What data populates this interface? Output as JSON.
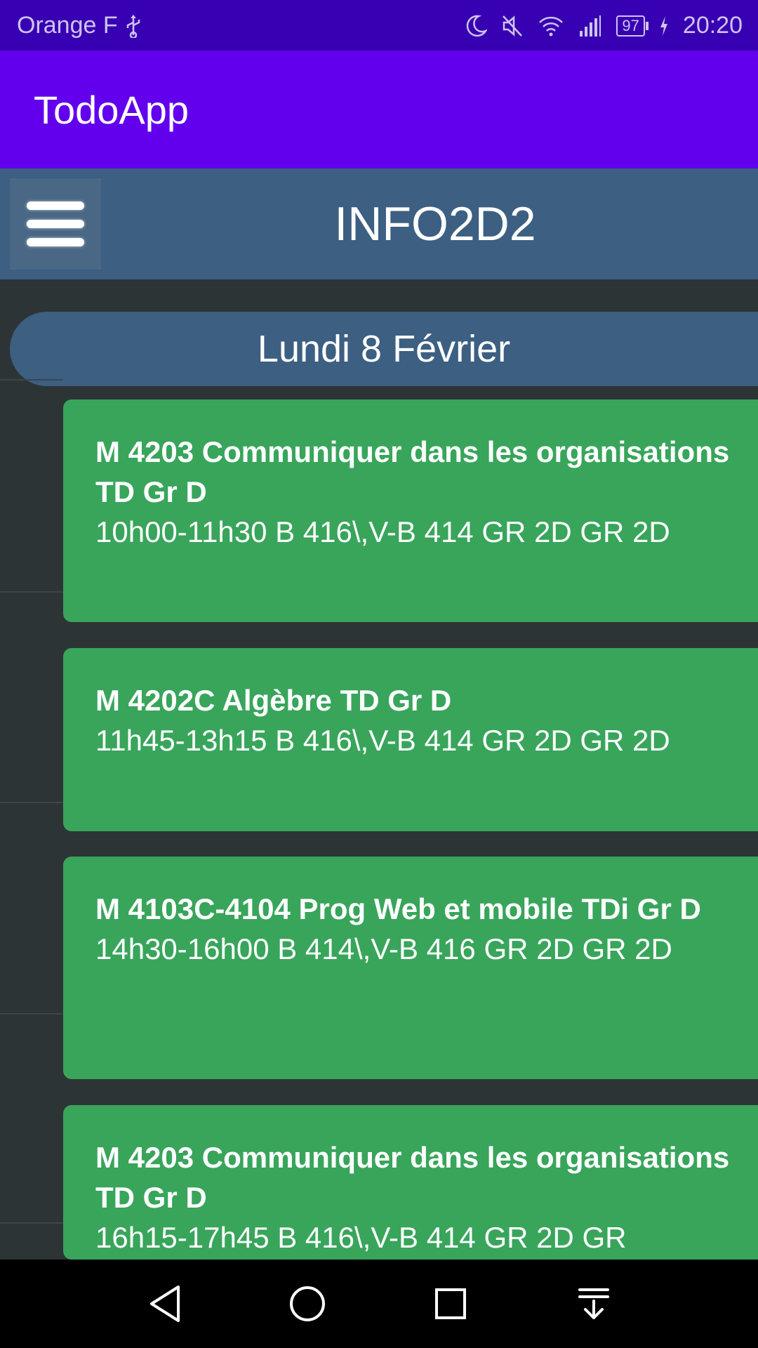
{
  "status_bar": {
    "carrier": "Orange F",
    "battery": "97",
    "time": "20:20"
  },
  "app_bar": {
    "title": "TodoApp"
  },
  "header": {
    "title": "INFO2D2",
    "menu_icon": "hamburger-menu-icon"
  },
  "schedule": {
    "day": "Lundi 8 Février",
    "courses": [
      {
        "title": "M 4203 Communiquer dans les organisations TD Gr D",
        "details": "10h00-11h30 B 416\\,V-B 414 GR 2D GR 2D"
      },
      {
        "title": "M 4202C Algèbre TD Gr D",
        "details": "11h45-13h15 B 416\\,V-B 414 GR 2D GR 2D"
      },
      {
        "title": "M 4103C-4104 Prog Web et mobile TDi Gr D",
        "details": "14h30-16h00 B 414\\,V-B 416 GR 2D GR 2D"
      },
      {
        "title": "M 4203 Communiquer dans les organisations TD Gr D",
        "details": "16h15-17h45 B 416\\,V-B 414 GR 2D GR"
      }
    ]
  },
  "colors": {
    "status_bar": "#3700b3",
    "app_bar": "#6200ee",
    "header": "#3c5f82",
    "background": "#2d3436",
    "card": "#38a55b"
  }
}
